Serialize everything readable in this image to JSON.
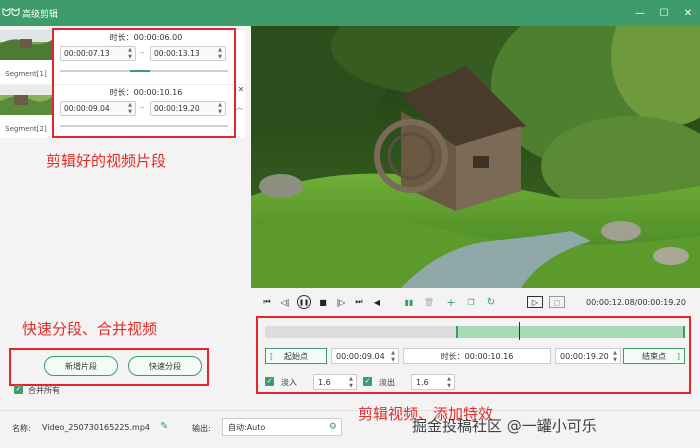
{
  "app": {
    "title": "高级剪辑",
    "logo": "app-logo-icon"
  },
  "window_buttons": {
    "minimize": "—",
    "maximize": "☐",
    "close": "✕"
  },
  "segments": [
    {
      "label": "Segment[1]",
      "duration": "时长：00:00:06.00",
      "start": "00:00:07.13",
      "end": "00:00:13.13",
      "progress": 0.12
    },
    {
      "label": "Segment[2]",
      "duration": "时长：00:00:10.16",
      "start": "00:00:09.04",
      "end": "00:00:19.20",
      "progress": 0.0
    }
  ],
  "annotations": {
    "edited_segments": "剪辑好的视频片段",
    "split_merge": "快速分段、合并视频",
    "effects": "剪辑视频、添加特效",
    "watermark": "掘金投稿社区 @一罐小可乐"
  },
  "buttons": {
    "new_segment": "新增片段",
    "quick_split": "快速分段",
    "merge_all": "合并所有"
  },
  "bottom": {
    "name_label": "名称:",
    "name_value": "Video_250730165225.mp4",
    "output_label": "输出:",
    "output_value": "自动:Auto"
  },
  "player": {
    "timecode": "00:00:12.08/00:00:19.20"
  },
  "timeline": {
    "selection_start": 0.455,
    "selection_end": 1.0,
    "playhead": 0.605
  },
  "clip": {
    "start_button": "起始点",
    "start_time": "00:00:09.04",
    "duration": "时长：00:00:10.16",
    "end_time": "00:00:19.20",
    "end_button": "结束点"
  },
  "fade": {
    "fade_in_label": "淡入",
    "fade_in_value": "1.6",
    "fade_out_label": "淡出",
    "fade_out_value": "1.6"
  },
  "colors": {
    "accent": "#3d9b6c",
    "annotation_red": "#e52a2a"
  }
}
